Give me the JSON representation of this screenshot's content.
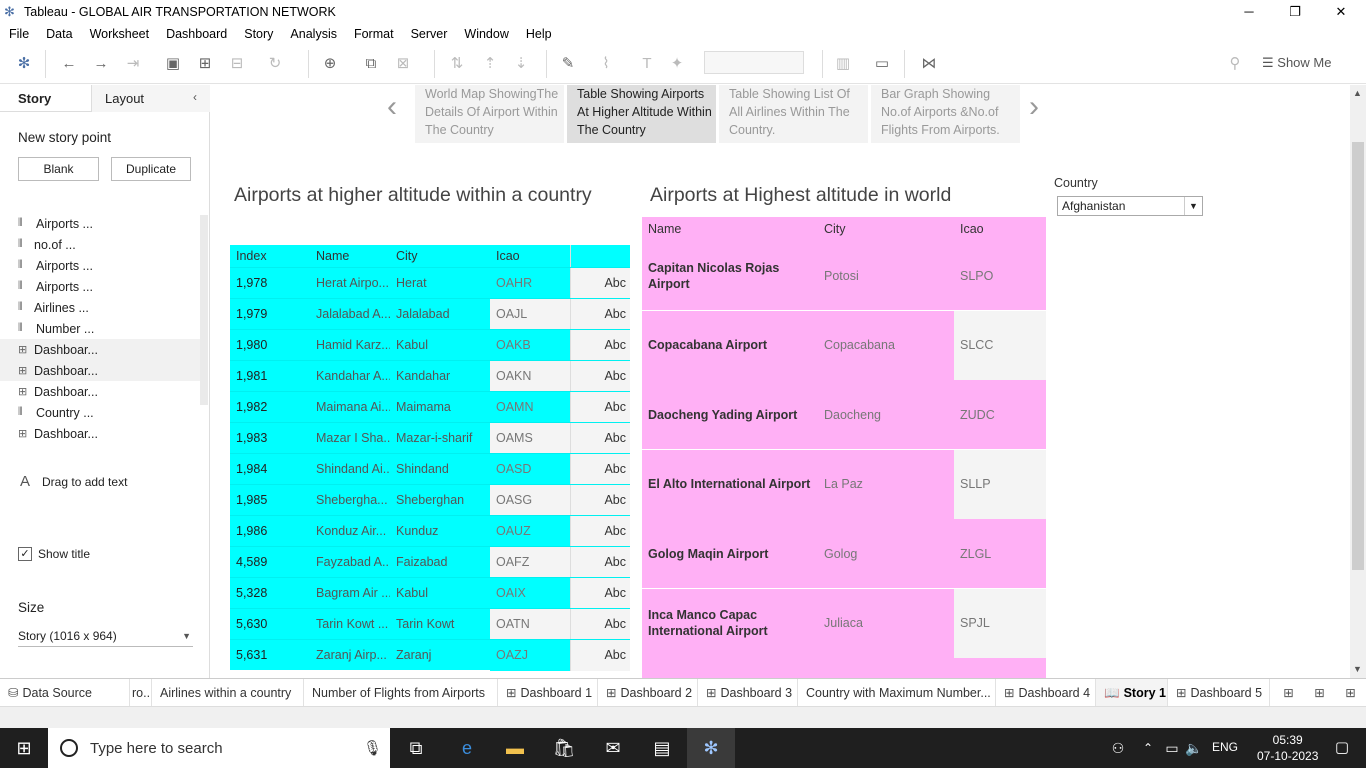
{
  "window": {
    "title": "Tableau - GLOBAL AIR TRANSPORTATION NETWORK"
  },
  "menu": [
    "File",
    "Data",
    "Worksheet",
    "Dashboard",
    "Story",
    "Analysis",
    "Format",
    "Server",
    "Window",
    "Help"
  ],
  "toolbar": {
    "show_me": "Show Me"
  },
  "left_panel": {
    "tab_story": "Story",
    "tab_layout": "Layout",
    "new_story_point": "New story point",
    "blank_button": "Blank",
    "duplicate_button": "Duplicate",
    "sheets": [
      {
        "label": "Airports ...",
        "icon": "worksheet-icon"
      },
      {
        "label": "no.of ...",
        "icon": "worksheet-icon"
      },
      {
        "label": "Airports ...",
        "icon": "worksheet-icon"
      },
      {
        "label": "Airports ...",
        "icon": "worksheet-icon"
      },
      {
        "label": "Airlines ...",
        "icon": "worksheet-icon"
      },
      {
        "label": "Number ...",
        "icon": "worksheet-icon"
      },
      {
        "label": "Dashboar...",
        "icon": "dashboard-icon"
      },
      {
        "label": "Dashboar...",
        "icon": "dashboard-icon"
      },
      {
        "label": "Dashboar...",
        "icon": "dashboard-icon"
      },
      {
        "label": "Country ...",
        "icon": "worksheet-icon"
      },
      {
        "label": "Dashboar...",
        "icon": "dashboard-icon"
      }
    ],
    "drag_text": "Drag to add text",
    "show_title": "Show title",
    "size_label": "Size",
    "size_value": "Story (1016 x 964)"
  },
  "story_points": [
    "World Map ShowingThe Details Of Airport Within The Country",
    "Table Showing Airports At Higher Altitude Within The Country",
    "Table Showing List Of All Airlines Within The Country.",
    "Bar Graph Showing No.of Airports &No.of Flights From Airports."
  ],
  "chart1": {
    "title": "Airports at higher altitude within a country",
    "columns": [
      "Index",
      "Name",
      "City",
      "Icao",
      ""
    ],
    "rows": [
      [
        "1,978",
        "Herat Airpo...",
        "Herat",
        "OAHR",
        "Abc"
      ],
      [
        "1,979",
        "Jalalabad A...",
        "Jalalabad",
        "OAJL",
        "Abc"
      ],
      [
        "1,980",
        "Hamid Karz...",
        "Kabul",
        "OAKB",
        "Abc"
      ],
      [
        "1,981",
        "Kandahar A...",
        "Kandahar",
        "OAKN",
        "Abc"
      ],
      [
        "1,982",
        "Maimana Ai...",
        "Maimama",
        "OAMN",
        "Abc"
      ],
      [
        "1,983",
        "Mazar I Sha...",
        "Mazar-i-sharif",
        "OAMS",
        "Abc"
      ],
      [
        "1,984",
        "Shindand Ai...",
        "Shindand",
        "OASD",
        "Abc"
      ],
      [
        "1,985",
        "Shebergha...",
        "Sheberghan",
        "OASG",
        "Abc"
      ],
      [
        "1,986",
        "Konduz Air...",
        "Kunduz",
        "OAUZ",
        "Abc"
      ],
      [
        "4,589",
        "Fayzabad A...",
        "Faizabad",
        "OAFZ",
        "Abc"
      ],
      [
        "5,328",
        "Bagram Air ...",
        "Kabul",
        "OAIX",
        "Abc"
      ],
      [
        "5,630",
        "Tarin Kowt ...",
        "Tarin Kowt",
        "OATN",
        "Abc"
      ],
      [
        "5,631",
        "Zaranj Airp...",
        "Zaranj",
        "OAZJ",
        "Abc"
      ]
    ],
    "icao_highlight": [
      true,
      false,
      true,
      false,
      true,
      false,
      true,
      false,
      true,
      false,
      true,
      false,
      true
    ]
  },
  "chart2": {
    "title": "Airports at Highest altitude in world",
    "columns": [
      "Name",
      "City",
      "Icao"
    ],
    "rows": [
      [
        "Capitan Nicolas Rojas Airport",
        "Potosi",
        "SLPO"
      ],
      [
        "Copacabana Airport",
        "Copacabana",
        "SLCC"
      ],
      [
        "Daocheng Yading Airport",
        "Daocheng",
        "ZUDC"
      ],
      [
        "El Alto International Airport",
        "La Paz",
        "SLLP"
      ],
      [
        "Golog Maqin Airport",
        "Golog",
        "ZLGL"
      ],
      [
        "Inca Manco Capac International Airport",
        "Juliaca",
        "SPJL"
      ]
    ],
    "icao_highlight": [
      true,
      false,
      true,
      false,
      true,
      false
    ]
  },
  "filter": {
    "label": "Country",
    "value": "Afghanistan"
  },
  "sheet_tabs": [
    {
      "label": "Data Source",
      "icon": "database-icon"
    },
    {
      "label": "ro...",
      "icon": ""
    },
    {
      "label": "Airlines within a country",
      "icon": ""
    },
    {
      "label": "Number of Flights from Airports",
      "icon": ""
    },
    {
      "label": "Dashboard 1",
      "icon": "dashboard-icon"
    },
    {
      "label": "Dashboard 2",
      "icon": "dashboard-icon"
    },
    {
      "label": "Dashboard 3",
      "icon": "dashboard-icon"
    },
    {
      "label": "Country with Maximum Number...",
      "icon": ""
    },
    {
      "label": "Dashboard 4",
      "icon": "dashboard-icon"
    },
    {
      "label": "Story 1",
      "icon": "story-icon"
    },
    {
      "label": "Dashboard 5",
      "icon": "dashboard-icon"
    }
  ],
  "taskbar": {
    "search_placeholder": "Type here to search",
    "lang": "ENG",
    "time": "05:39",
    "date": "07-10-2023"
  },
  "colors": {
    "cyan": "#00ffff",
    "pink": "#ffb0f5",
    "white_cell": "#f4f4f4"
  }
}
